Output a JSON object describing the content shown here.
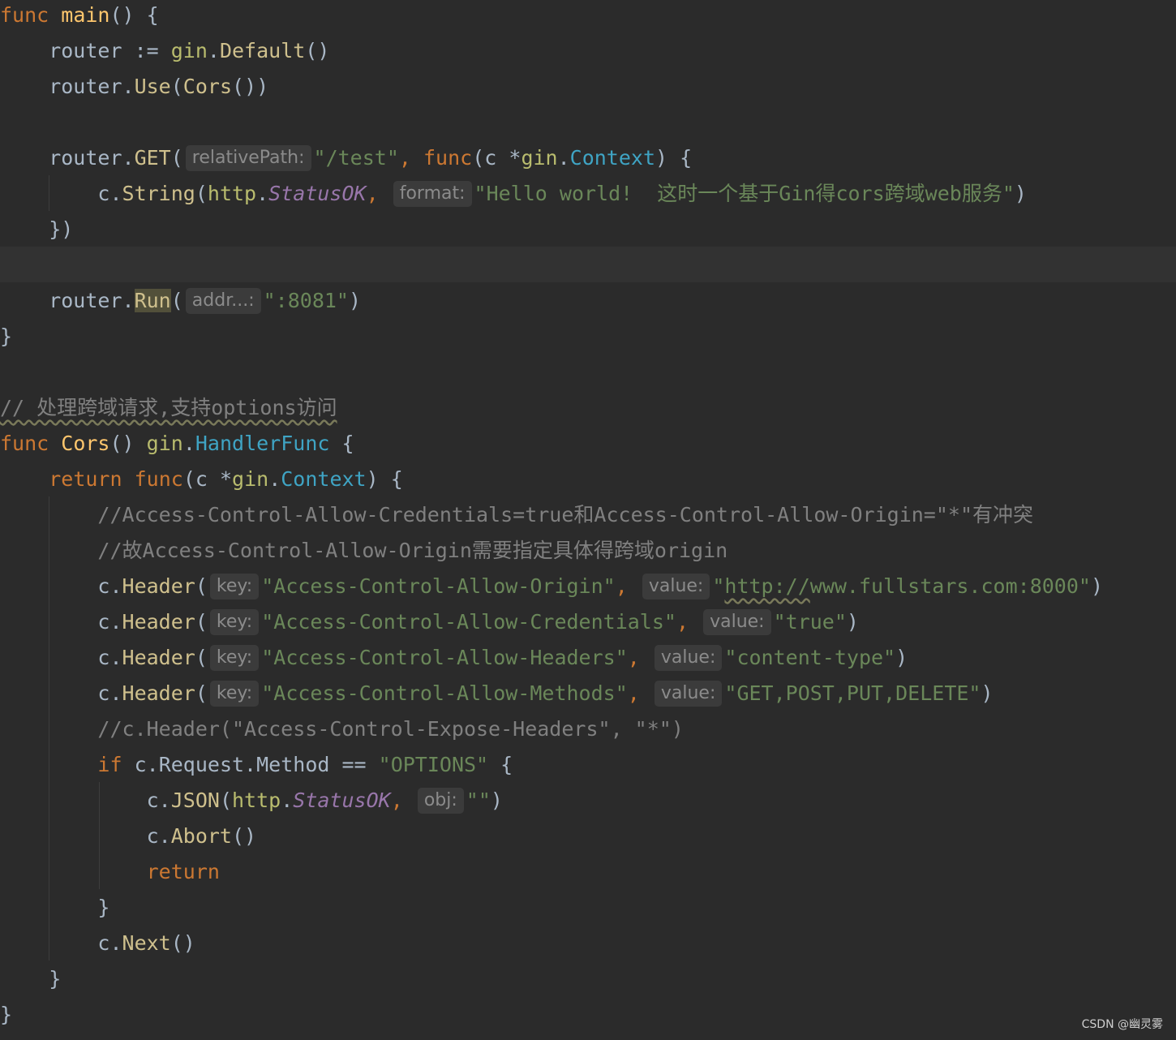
{
  "code": {
    "main": {
      "kw_func": "func",
      "name": "main",
      "open": "() {",
      "l1_router": "    router := ",
      "l1_pkg": "gin",
      "l1_dot": ".",
      "l1_fn": "Default",
      "l1_end": "()",
      "l2_router": "    router.",
      "l2_fn": "Use",
      "l2_paren": "(",
      "l2_fn2": "Cors",
      "l2_end": "())",
      "l4_router": "    router.",
      "l4_fn": "GET",
      "l4_paren": "(",
      "l4_hint": "relativePath:",
      "l4_str": "\"/test\"",
      "l4_comma": ", ",
      "l4_kw": "func",
      "l4_args": "(c *",
      "l4_pkg": "gin",
      "l4_dot": ".",
      "l4_type": "Context",
      "l4_end": ") {",
      "l5_c": "        c.",
      "l5_fn": "String",
      "l5_paren": "(",
      "l5_pkg": "http",
      "l5_dot": ".",
      "l5_const": "StatusOK",
      "l5_comma": ", ",
      "l5_hint": "format:",
      "l5_str": "\"Hello world!  这时一个基于Gin得cors跨域web服务\"",
      "l5_end": ")",
      "l6": "    })",
      "l8_router": "    router.",
      "l8_fn": "Run",
      "l8_paren": "(",
      "l8_hint": "addr...:",
      "l8_str": "\":8081\"",
      "l8_end": ")",
      "close": "}"
    },
    "cors": {
      "comment": "// 处理跨域请求,支持options访问",
      "kw_func": "func",
      "name": "Cors",
      "sig_mid": "() ",
      "sig_pkg": "gin",
      "sig_dot": ".",
      "sig_type": "HandlerFunc",
      "sig_end": " {",
      "r_indent": "    ",
      "r_kw": "return",
      "r_sp": " ",
      "r_func": "func",
      "r_args": "(c *",
      "r_pkg": "gin",
      "r_dot": ".",
      "r_type": "Context",
      "r_end": ") {",
      "c1": "        //Access-Control-Allow-Credentials=true和Access-Control-Allow-Origin=\"*\"有冲突",
      "c2": "        //故Access-Control-Allow-Origin需要指定具体得跨域origin",
      "headers": [
        {
          "pre": "        c.",
          "fn": "Header",
          "paren": "(",
          "key_hint": "key:",
          "key": "\"Access-Control-Allow-Origin\"",
          "comma": ", ",
          "value_hint": "value:",
          "value_q": "\"",
          "value_url": "http://",
          "value_rest": "www.fullstars.com:8000\"",
          "end": ")"
        },
        {
          "pre": "        c.",
          "fn": "Header",
          "paren": "(",
          "key_hint": "key:",
          "key": "\"Access-Control-Allow-Credentials\"",
          "comma": ", ",
          "value_hint": "value:",
          "value": "\"true\"",
          "end": ")"
        },
        {
          "pre": "        c.",
          "fn": "Header",
          "paren": "(",
          "key_hint": "key:",
          "key": "\"Access-Control-Allow-Headers\"",
          "comma": ", ",
          "value_hint": "value:",
          "value": "\"content-type\"",
          "end": ")"
        },
        {
          "pre": "        c.",
          "fn": "Header",
          "paren": "(",
          "key_hint": "key:",
          "key": "\"Access-Control-Allow-Methods\"",
          "comma": ", ",
          "value_hint": "value:",
          "value": "\"GET,POST,PUT,DELETE\"",
          "end": ")"
        }
      ],
      "c3": "        //c.Header(\"Access-Control-Expose-Headers\", \"*\")",
      "if_indent": "        ",
      "if_kw": "if",
      "if_mid": " c.",
      "if_field1": "Request",
      "if_dot": ".",
      "if_field2": "Method",
      "if_op": " == ",
      "if_str": "\"OPTIONS\"",
      "if_end": " {",
      "json_pre": "            c.",
      "json_fn": "JSON",
      "json_paren": "(",
      "json_pkg": "http",
      "json_dot": ".",
      "json_const": "StatusOK",
      "json_comma": ", ",
      "json_hint": "obj:",
      "json_str": "\"\"",
      "json_end": ")",
      "abort_pre": "            c.",
      "abort_fn": "Abort",
      "abort_end": "()",
      "ret_indent": "            ",
      "ret_kw": "return",
      "if_close": "        }",
      "next_pre": "        c.",
      "next_fn": "Next",
      "next_end": "()",
      "func_close": "    }",
      "close": "}"
    }
  },
  "watermark": "CSDN @幽灵雾",
  "colors": {
    "background": "#2b2b2b",
    "keyword": "#cc7832",
    "function": "#ffc66d",
    "string": "#6a8759",
    "comment": "#808080",
    "type": "#3fa4c4",
    "constant": "#9876aa",
    "default": "#a9b7c6"
  }
}
